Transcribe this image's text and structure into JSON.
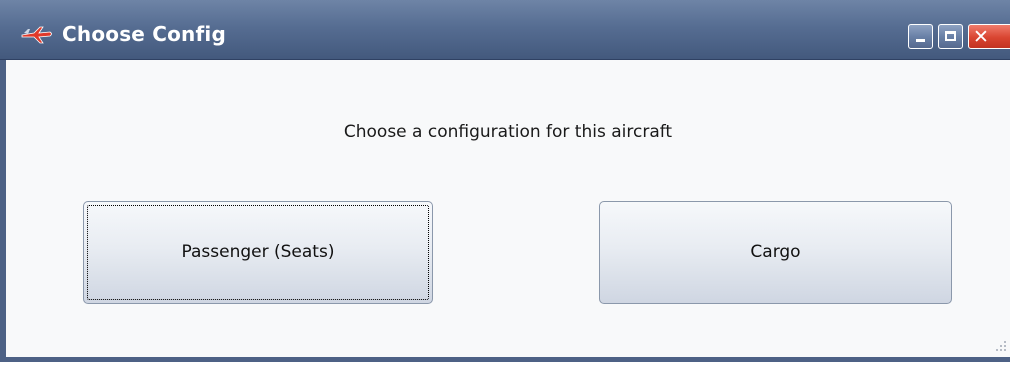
{
  "window": {
    "title": "Choose Config"
  },
  "dialog": {
    "prompt": "Choose a configuration for this aircraft",
    "passenger_button_label": "Passenger (Seats)",
    "cargo_button_label": "Cargo",
    "focused_button": "passenger"
  },
  "icons": {
    "app": "aircraft-icon",
    "minimize": "minimize-icon",
    "maximize": "maximize-icon",
    "close": "close-icon",
    "resize": "resize-grip-icon"
  },
  "colors": {
    "titlebar": "#566d92",
    "close_button": "#d94531",
    "client_background": "#f8f9fa",
    "button_border": "#8b98ab"
  }
}
